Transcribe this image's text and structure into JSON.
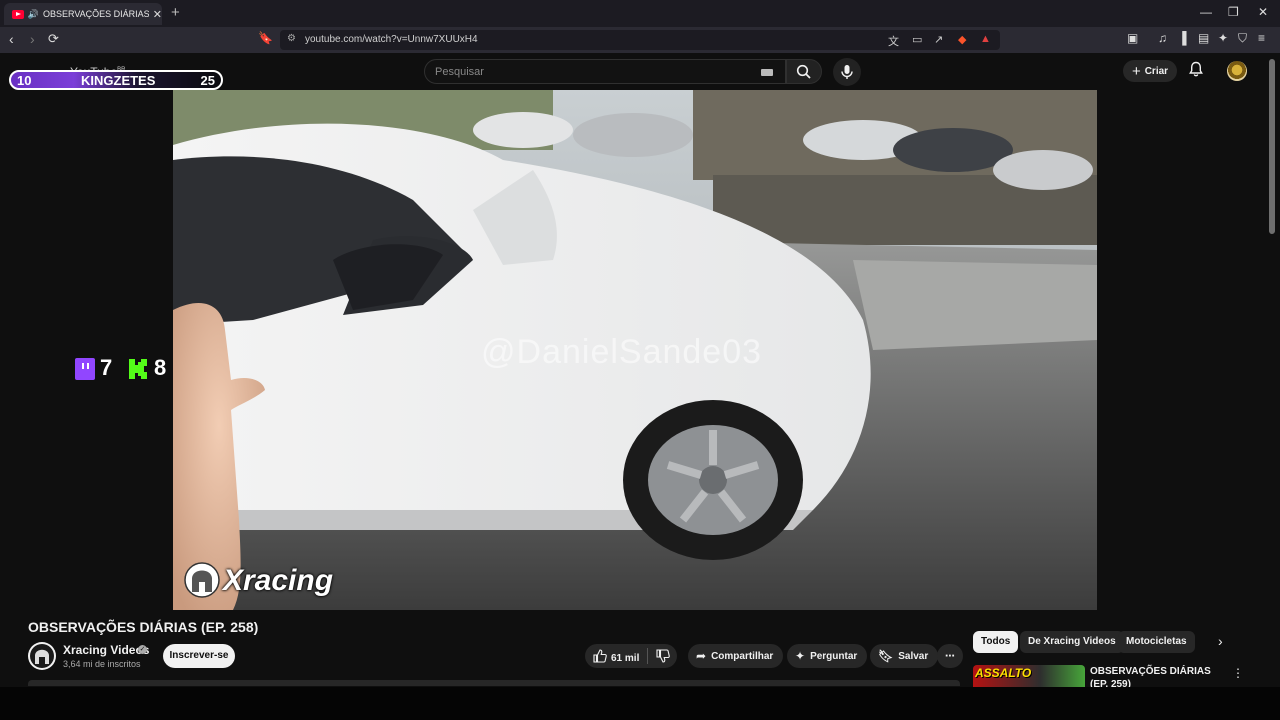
{
  "browser": {
    "tab_title": "OBSERVAÇÕES DIÁRIAS (EP. 2",
    "tab_close": "✕",
    "new_tab": "+",
    "url": "youtube.com/watch?v=Unnw7XUUxH4",
    "window_minimize": "—",
    "window_restore": "❐",
    "window_close": "✕"
  },
  "header": {
    "logo_text": "YouTube",
    "logo_region": "BR",
    "search_placeholder": "Pesquisar",
    "create_label": "Criar"
  },
  "stream_overlay": {
    "score_left": "10",
    "score_name": "KINGZETES",
    "score_right": "25",
    "twitch_count": "7",
    "kick_count": "8",
    "colors": {
      "twitch": "#9146ff",
      "kick": "#53fc18",
      "scoreboard": "#7b3fd8"
    }
  },
  "video": {
    "watermark": "@DanielSande03",
    "channel_logo_text": "Xracing"
  },
  "video_info": {
    "title": "OBSERVAÇÕES DIÁRIAS (EP. 258)",
    "channel_name": "Xracing Videos",
    "verified_mark": "✓",
    "subscribers": "3,64 mi de inscritos",
    "subscribe_label": "Inscrever-se"
  },
  "actions": {
    "like_count": "61 mil",
    "share_label": "Compartilhar",
    "ask_label": "Perguntar",
    "save_label": "Salvar",
    "more_label": "⋯"
  },
  "recommendations": {
    "chips": [
      "Todos",
      "De Xracing Videos",
      "Motocicletas"
    ],
    "next_arrow": "›",
    "items": [
      {
        "thumb_text": "ASSALTO",
        "title": "OBSERVAÇÕES DIÁRIAS (EP. 259)"
      }
    ]
  },
  "icons": [
    "back-icon",
    "forward-icon",
    "reload-icon",
    "bookmark-icon",
    "translate-icon",
    "search-icon",
    "mic-icon",
    "bell-icon",
    "like-icon",
    "dislike-icon",
    "share-icon",
    "sparkle-icon",
    "save-icon"
  ]
}
